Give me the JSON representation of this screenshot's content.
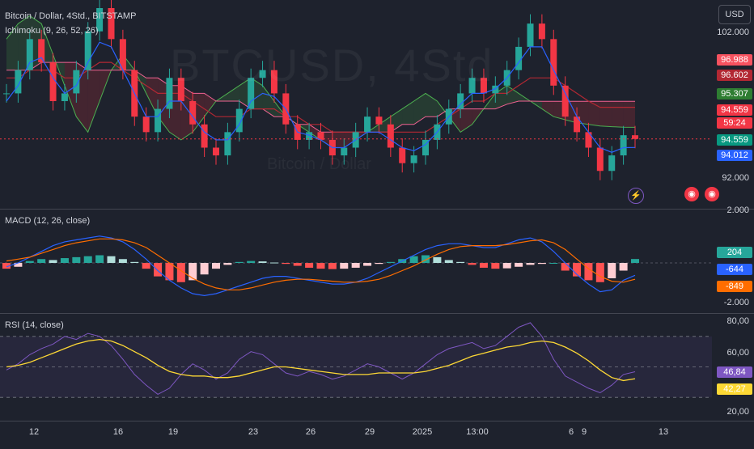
{
  "header": {
    "symbol": "Bitcoin / Dollar, 4Std., BITSTAMP",
    "ichimoku": "Ichimoku (9, 26, 52, 26)",
    "currency_button": "USD"
  },
  "watermark": {
    "main": "BTCUSD, 4Std",
    "sub": "Bitcoin / Dollar"
  },
  "price_axis": {
    "ticks": [
      "102.000",
      "92.000"
    ],
    "tags": [
      {
        "value": "96.988",
        "color": "#f7525f"
      },
      {
        "value": "96.602",
        "color": "#b22833"
      },
      {
        "value": "95.307",
        "color": "#2e7d32"
      },
      {
        "value": "94.559",
        "color": "#f23645"
      },
      {
        "value": "59:24",
        "color": "#f23645"
      },
      {
        "value": "94.559",
        "color": "#089981"
      },
      {
        "value": "94.012",
        "color": "#2962ff"
      }
    ]
  },
  "macd": {
    "title": "MACD (12, 26, close)",
    "ticks": [
      "2.000",
      "-2.000"
    ],
    "tags": [
      {
        "value": "204",
        "color": "#26a69a"
      },
      {
        "value": "-644",
        "color": "#2962ff"
      },
      {
        "value": "-849",
        "color": "#ff6d00"
      }
    ]
  },
  "rsi": {
    "title": "RSI (14, close)",
    "ticks": [
      "80,00",
      "60,00",
      "20,00"
    ],
    "tags": [
      {
        "value": "46,84",
        "color": "#7e57c2"
      },
      {
        "value": "42,27",
        "color": "#fdd835"
      }
    ]
  },
  "time_axis": [
    "12",
    "16",
    "19",
    "23",
    "26",
    "29",
    "2025",
    "13:00",
    "6",
    "9",
    "13"
  ],
  "colors": {
    "up": "#26a69a",
    "down": "#f23645",
    "tenkan": "#2962ff",
    "kijun": "#b22833",
    "span_a": "#4caf50",
    "span_b": "#f06292",
    "macd": "#2962ff",
    "signal": "#ff6d00",
    "rsi": "#7e57c2",
    "rsi_ma": "#fdd835"
  },
  "chart_data": [
    {
      "type": "candlestick",
      "title": "Bitcoin / Dollar, 4Std., BITSTAMP",
      "ylim": [
        91000,
        103000
      ],
      "x_labels": [
        "12",
        "16",
        "19",
        "23",
        "26",
        "29",
        "2025",
        "13:00",
        "6",
        "9",
        "13"
      ],
      "close": [
        97500,
        99000,
        101000,
        99500,
        97000,
        97500,
        99000,
        101500,
        103000,
        101000,
        99000,
        96000,
        95000,
        96500,
        98500,
        97000,
        95500,
        94000,
        93500,
        95000,
        96500,
        98500,
        99000,
        97500,
        95500,
        94500,
        95000,
        94500,
        93500,
        94000,
        95000,
        96000,
        95500,
        94000,
        93000,
        93500,
        94500,
        95500,
        96500,
        97500,
        98500,
        97500,
        98000,
        99000,
        100500,
        102000,
        101000,
        98000,
        96000,
        95000,
        94000,
        92500,
        93500,
        94800,
        94559
      ],
      "tenkan": [
        97000,
        98000,
        99500,
        99800,
        98500,
        97500,
        98000,
        99500,
        100800,
        100500,
        99000,
        97500,
        96000,
        96000,
        97000,
        97000,
        96000,
        95000,
        94500,
        94500,
        95500,
        97000,
        97500,
        97300,
        96500,
        95000,
        94800,
        94500,
        94000,
        94000,
        94500,
        95000,
        95000,
        94500,
        94000,
        93800,
        94200,
        95000,
        96000,
        96800,
        97500,
        97500,
        97800,
        98500,
        99500,
        100500,
        100500,
        99000,
        97500,
        96000,
        95000,
        94000,
        93700,
        94000,
        94012
      ],
      "kijun": [
        98500,
        98500,
        99000,
        99000,
        99000,
        98500,
        98500,
        99000,
        99500,
        99500,
        99000,
        98500,
        98000,
        97500,
        97500,
        97500,
        97000,
        96500,
        96000,
        96000,
        96000,
        96500,
        96500,
        96500,
        96000,
        96000,
        95500,
        95500,
        95000,
        95000,
        95000,
        95000,
        95000,
        95000,
        95000,
        95000,
        95000,
        95500,
        96000,
        96500,
        97000,
        97000,
        97500,
        97500,
        98000,
        98500,
        98500,
        98500,
        98000,
        97500,
        97000,
        96602,
        96602,
        96602,
        96602
      ],
      "span_a": [
        101000,
        102000,
        102500,
        102000,
        100000,
        98000,
        96000,
        95000,
        97000,
        99000,
        100000,
        99000,
        97500,
        96000,
        95000,
        94500,
        95000,
        96000,
        97000,
        97500,
        98000,
        98500,
        98000,
        97000,
        96000,
        95500,
        95000,
        94500,
        94000,
        94000,
        94500,
        95000,
        95500,
        96000,
        96500,
        97000,
        97500,
        97000,
        96000,
        95000,
        95500,
        96500,
        97500,
        98000,
        97500,
        97000,
        96500,
        96000,
        95800,
        95600,
        95500,
        95400,
        95350,
        95320,
        95307
      ],
      "span_b": [
        99000,
        99000,
        99000,
        99500,
        99500,
        99500,
        99500,
        99000,
        99000,
        99000,
        99000,
        99000,
        98500,
        98500,
        98000,
        98000,
        97500,
        97500,
        97000,
        97000,
        97000,
        96500,
        96500,
        96000,
        96000,
        95500,
        95500,
        95000,
        95000,
        95000,
        95000,
        95000,
        95000,
        95000,
        95500,
        95500,
        96000,
        96000,
        96500,
        96500,
        96500,
        96500,
        96500,
        96800,
        97000,
        97000,
        96988,
        96988,
        96988,
        96988,
        96988,
        96988,
        96988,
        96988,
        96988
      ]
    },
    {
      "type": "bar",
      "title": "MACD (12, 26, close)",
      "ylim": [
        -2400,
        2400
      ],
      "histogram": [
        -300,
        -200,
        100,
        200,
        150,
        250,
        300,
        350,
        400,
        350,
        200,
        50,
        -300,
        -700,
        -900,
        -1000,
        -900,
        -600,
        -300,
        -100,
        50,
        100,
        80,
        20,
        -50,
        -150,
        -250,
        -300,
        -320,
        -300,
        -250,
        -150,
        -50,
        50,
        200,
        350,
        400,
        300,
        150,
        50,
        -100,
        -250,
        -300,
        -280,
        -200,
        -100,
        -50,
        0,
        -400,
        -700,
        -900,
        -1000,
        -800,
        -400,
        204
      ],
      "macd": [
        -200,
        0,
        300,
        600,
        900,
        1100,
        1200,
        1300,
        1400,
        1300,
        1100,
        700,
        200,
        -400,
        -900,
        -1300,
        -1600,
        -1700,
        -1600,
        -1400,
        -1200,
        -1000,
        -800,
        -700,
        -700,
        -800,
        -900,
        -1000,
        -1100,
        -1100,
        -1000,
        -800,
        -500,
        -200,
        100,
        400,
        700,
        900,
        1000,
        1000,
        900,
        800,
        800,
        1000,
        1200,
        1300,
        1100,
        600,
        0,
        -600,
        -1100,
        -1500,
        -1400,
        -900,
        -644
      ],
      "signal": [
        100,
        200,
        300,
        500,
        700,
        900,
        1050,
        1150,
        1250,
        1250,
        1200,
        1050,
        800,
        400,
        0,
        -400,
        -800,
        -1100,
        -1300,
        -1400,
        -1400,
        -1300,
        -1150,
        -1000,
        -900,
        -850,
        -850,
        -900,
        -950,
        -1000,
        -1000,
        -950,
        -850,
        -650,
        -400,
        -150,
        150,
        450,
        700,
        850,
        900,
        900,
        900,
        950,
        1050,
        1150,
        1200,
        1050,
        700,
        200,
        -300,
        -700,
        -950,
        -1000,
        -849
      ]
    },
    {
      "type": "line",
      "title": "RSI (14, close)",
      "ylim": [
        20,
        80
      ],
      "rsi": [
        48,
        52,
        58,
        62,
        65,
        70,
        68,
        72,
        70,
        64,
        55,
        45,
        38,
        32,
        36,
        45,
        52,
        48,
        42,
        46,
        55,
        60,
        58,
        52,
        46,
        44,
        47,
        45,
        42,
        44,
        48,
        52,
        50,
        46,
        42,
        46,
        52,
        58,
        62,
        64,
        66,
        62,
        64,
        70,
        76,
        79,
        70,
        55,
        44,
        40,
        36,
        33,
        38,
        45,
        46.84
      ],
      "rsi_ma": [
        50,
        51,
        53,
        56,
        59,
        62,
        65,
        67,
        68,
        67,
        64,
        60,
        56,
        51,
        47,
        45,
        44,
        44,
        43,
        43,
        44,
        46,
        48,
        50,
        50,
        49,
        48,
        47,
        46,
        45,
        45,
        45,
        46,
        46,
        46,
        46,
        47,
        49,
        51,
        54,
        57,
        59,
        61,
        63,
        64,
        66,
        67,
        66,
        63,
        59,
        54,
        48,
        43,
        41,
        42.27
      ]
    }
  ]
}
